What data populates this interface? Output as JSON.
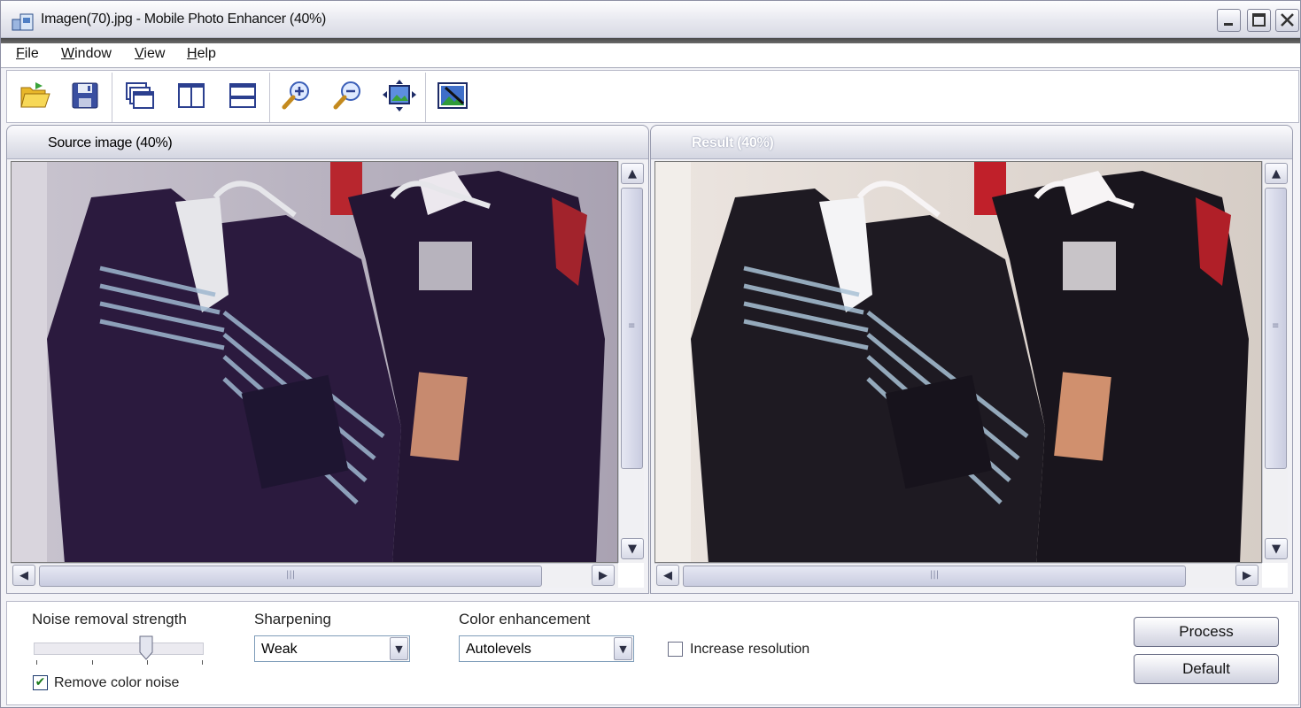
{
  "window": {
    "title": "Imagen(70).jpg - Mobile Photo Enhancer (40%)",
    "icons": [
      "app-icon",
      "minimize-icon",
      "maximize-icon",
      "close-icon"
    ]
  },
  "menu": {
    "items": [
      "File",
      "Window",
      "View",
      "Help"
    ]
  },
  "toolbar": {
    "buttons": [
      "open-folder-icon",
      "save-icon",
      "cascade-windows-icon",
      "split-vertical-icon",
      "split-horizontal-icon",
      "zoom-in-icon",
      "zoom-out-icon",
      "fit-to-window-icon",
      "enhance-image-icon"
    ]
  },
  "panels": {
    "source_title": "Source image (40%)",
    "result_title": "Result (40%)"
  },
  "controls": {
    "noise_label": "Noise removal strength",
    "noise_level_fraction": 0.66,
    "remove_color_noise_label": "Remove color noise",
    "remove_color_noise_checked": true,
    "sharpening_label": "Sharpening",
    "sharpening_value": "Weak",
    "color_label": "Color enhancement",
    "color_value": "Autolevels",
    "increase_resolution_label": "Increase resolution",
    "increase_resolution_checked": false,
    "process_button": "Process",
    "default_button": "Default"
  },
  "colors": {
    "accent": "#1c3a6e",
    "check_mark": "#1a7a1a"
  }
}
